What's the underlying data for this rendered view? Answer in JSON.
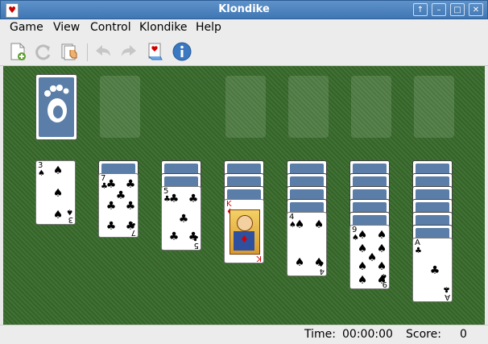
{
  "window": {
    "title": "Klondike",
    "app_icon": "cards-icon",
    "buttons": [
      "↑",
      "–",
      "□",
      "✕"
    ]
  },
  "menu": [
    "Game",
    "View",
    "Control",
    "Klondike",
    "Help"
  ],
  "toolbar": [
    "new-game-icon",
    "restart-icon",
    "deal-icon",
    "undo-icon",
    "redo-icon",
    "hint-icon",
    "info-icon"
  ],
  "tableau": [
    {
      "hidden": 0,
      "top": {
        "rank": "3",
        "suit": "♠",
        "color": "black"
      }
    },
    {
      "hidden": 1,
      "top": {
        "rank": "7",
        "suit": "♣",
        "color": "black"
      }
    },
    {
      "hidden": 2,
      "top": {
        "rank": "5",
        "suit": "♣",
        "color": "black"
      }
    },
    {
      "hidden": 3,
      "top": {
        "rank": "K",
        "suit": "♦",
        "color": "red"
      }
    },
    {
      "hidden": 4,
      "top": {
        "rank": "4",
        "suit": "♠",
        "color": "black"
      }
    },
    {
      "hidden": 5,
      "top": {
        "rank": "9",
        "suit": "♠",
        "color": "black"
      }
    },
    {
      "hidden": 6,
      "top": {
        "rank": "A",
        "suit": "♣",
        "color": "black"
      }
    }
  ],
  "status": {
    "time_label": "Time:",
    "time_value": "00:00:00",
    "score_label": "Score:",
    "score_value": "0"
  }
}
